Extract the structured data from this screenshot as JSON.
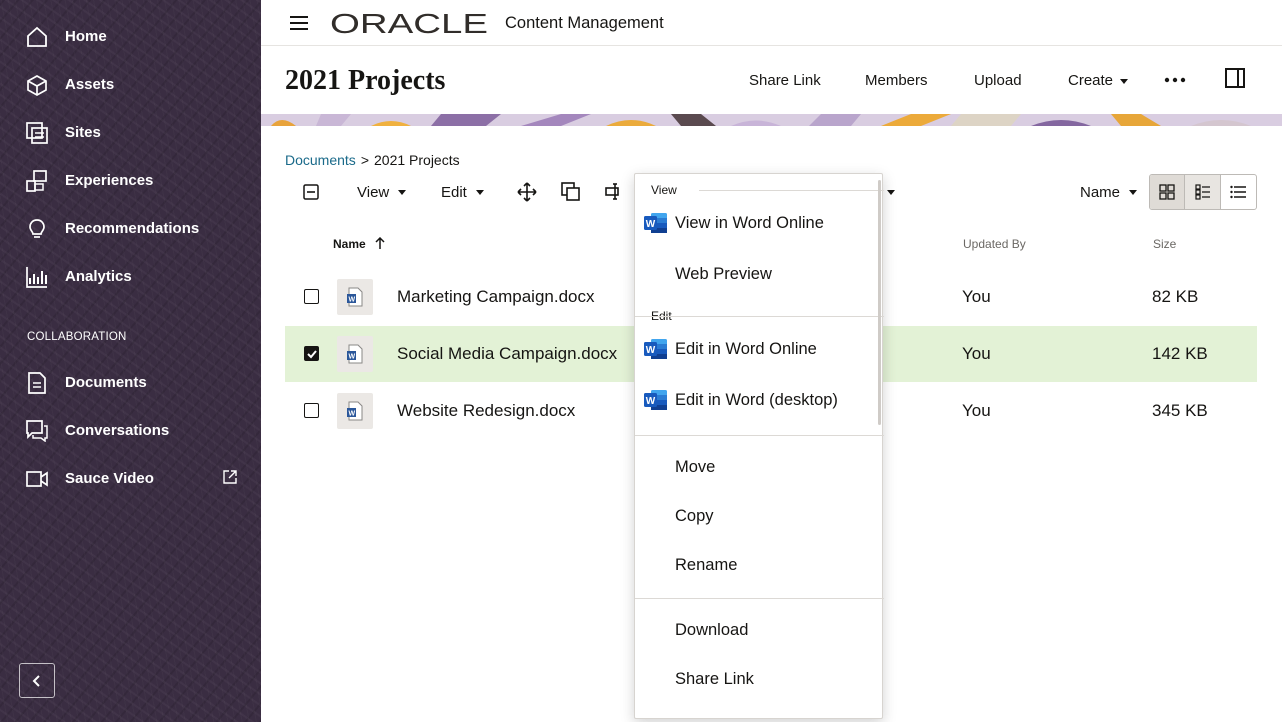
{
  "sidebar": {
    "items": [
      {
        "label": "Home",
        "icon": "home-icon"
      },
      {
        "label": "Assets",
        "icon": "cube-icon"
      },
      {
        "label": "Sites",
        "icon": "sites-icon"
      },
      {
        "label": "Experiences",
        "icon": "experiences-icon"
      },
      {
        "label": "Recommendations",
        "icon": "lightbulb-icon"
      },
      {
        "label": "Analytics",
        "icon": "analytics-chart-icon"
      }
    ],
    "section_label": "COLLABORATION",
    "collab_items": [
      {
        "label": "Documents",
        "icon": "document-icon"
      },
      {
        "label": "Conversations",
        "icon": "conversation-icon"
      },
      {
        "label": "Sauce Video",
        "icon": "video-icon",
        "external": "external-link-icon"
      }
    ],
    "collapse_icon": "chevron-left-icon"
  },
  "topbar": {
    "logo_text": "ORACLE",
    "product": "Content Management"
  },
  "header": {
    "title": "2021 Projects",
    "share_link": "Share Link",
    "members": "Members",
    "upload": "Upload",
    "create": "Create"
  },
  "breadcrumb": {
    "root": "Documents",
    "separator": ">",
    "current": "2021 Projects"
  },
  "toolbar": {
    "view": "View",
    "edit": "Edit",
    "sort": "Name"
  },
  "columns": {
    "name": "Name",
    "updated_by": "Updated By",
    "size": "Size"
  },
  "files": [
    {
      "name": "Marketing Campaign.docx",
      "updated_by": "You",
      "size": "82 KB",
      "selected": false
    },
    {
      "name": "Social Media Campaign.docx",
      "updated_by": "You",
      "size": "142 KB",
      "selected": true
    },
    {
      "name": "Website Redesign.docx",
      "updated_by": "You",
      "size": "345 KB",
      "selected": false
    }
  ],
  "context_menu": {
    "view_group": "View",
    "view_word_online": "View in Word Online",
    "web_preview": "Web Preview",
    "edit_group": "Edit",
    "edit_word_online": "Edit in Word Online",
    "edit_word_desktop": "Edit in Word (desktop)",
    "move": "Move",
    "copy": "Copy",
    "rename": "Rename",
    "download": "Download",
    "share_link": "Share Link"
  },
  "colors": {
    "sidebar_bg": "#3a2d42",
    "selected_row": "#e3f2d6",
    "link": "#1a6a8a",
    "word_blue": "#2b579a"
  }
}
